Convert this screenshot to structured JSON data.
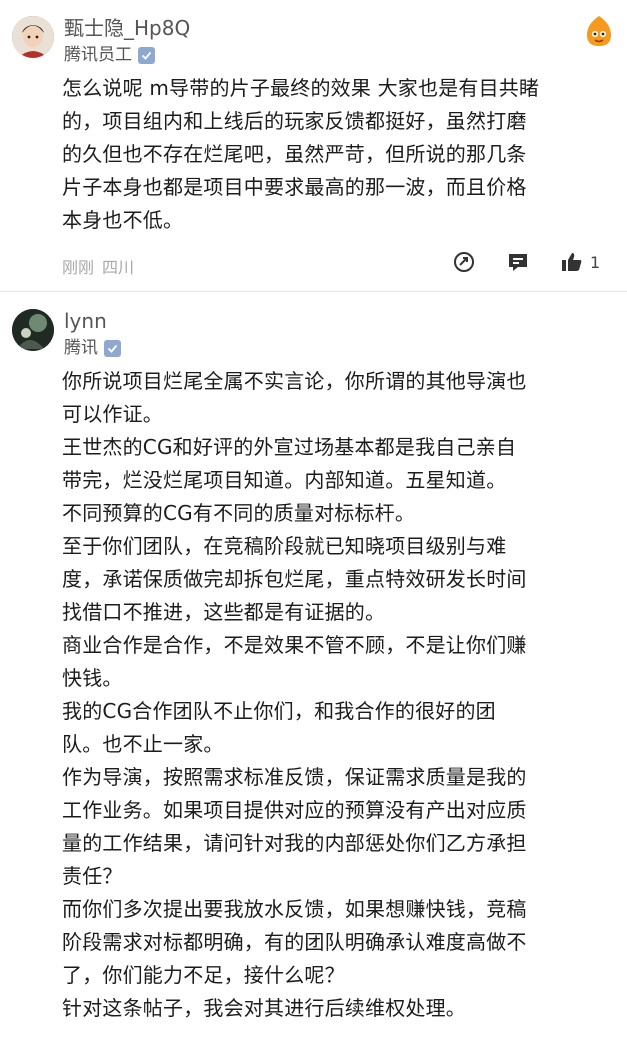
{
  "posts": [
    {
      "username": "甄士隐_Hp8Q",
      "affiliation": "腾讯员工",
      "content_lines": [
        "怎么说呢 m导带的片子最终的效果 大家也是有目共睹",
        "的，项目组内和上线后的玩家反馈都挺好，虽然打磨",
        "的久但也不存在烂尾吧，虽然严苛，但所说的那几条",
        "片子本身也都是项目中要求最高的那一波，而且价格",
        "本身也不低。"
      ],
      "time": "刚刚",
      "location": "四川",
      "like_count": "1",
      "icons": {
        "right": "emoji-sticker-icon",
        "share": "share-icon",
        "comment": "comment-icon",
        "like": "thumbs-up-icon"
      }
    },
    {
      "username": "lynn",
      "affiliation": "腾讯",
      "content_lines": [
        "你所说项目烂尾全属不实言论，你所谓的其他导演也",
        "可以作证。",
        "王世杰的CG和好评的外宣过场基本都是我自己亲自",
        "带完，烂没烂尾项目知道。内部知道。五星知道。",
        "不同预算的CG有不同的质量对标标杆。",
        "至于你们团队，在竞稿阶段就已知晓项目级别与难",
        "度，承诺保质做完却拆包烂尾，重点特效研发长时间",
        "找借口不推进，这些都是有证据的。",
        "商业合作是合作，不是效果不管不顾，不是让你们赚",
        "快钱。",
        "我的CG合作团队不止你们，和我合作的很好的团",
        "队。也不止一家。",
        "作为导演，按照需求标准反馈，保证需求质量是我的",
        "工作业务。如果项目提供对应的预算没有产出对应质",
        "量的工作结果，请问针对我的内部惩处你们乙方承担",
        "责任？",
        "而你们多次提出要我放水反馈，如果想赚快钱，竞稿",
        "阶段需求对标都明确，有的团队明确承认难度高做不",
        "了，你们能力不足，接什么呢？",
        "针对这条帖子，我会对其进行后续维权处理。"
      ]
    }
  ],
  "colors": {
    "text": "#1c1c1c",
    "meta": "#a8a8a8",
    "badge": "#8ea8cf",
    "username": "#555555"
  }
}
